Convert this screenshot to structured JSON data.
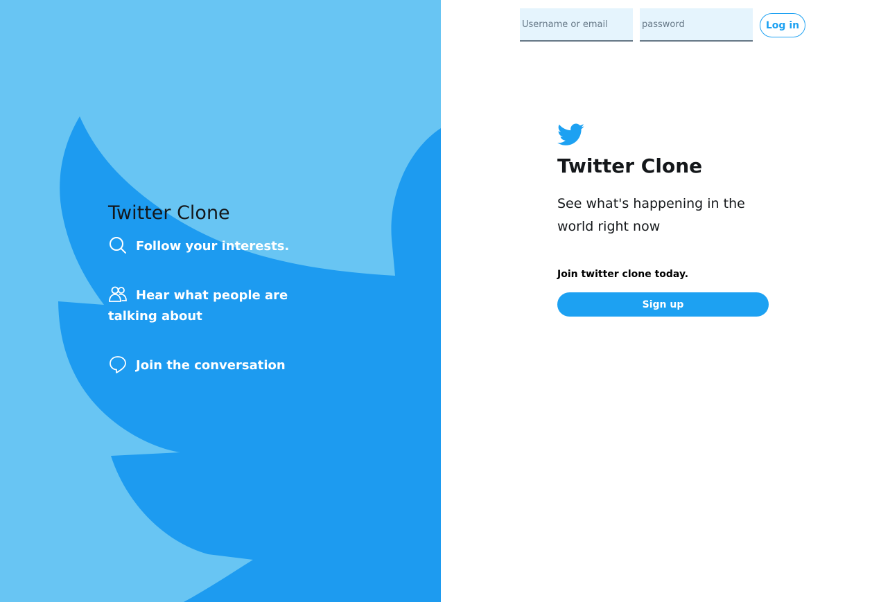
{
  "left": {
    "title": "Twitter Clone",
    "features": [
      {
        "icon": "search-icon",
        "text": "Follow your interests."
      },
      {
        "icon": "people-icon",
        "text": "Hear what people are talking about"
      },
      {
        "icon": "speech-bubble-icon",
        "text": "Join the conversation"
      }
    ]
  },
  "header": {
    "username_placeholder": "Username or email",
    "password_placeholder": "password",
    "login_label": "Log in"
  },
  "main": {
    "logo_icon": "twitter-bird-icon",
    "title": "Twitter Clone",
    "tagline": "See what's happening in the world right now",
    "join_text": "Join twitter clone today.",
    "signup_label": "Sign up"
  },
  "colors": {
    "brand_blue": "#1da1f2",
    "light_blue": "#68c5f3",
    "input_bg": "#e5f4fd"
  }
}
